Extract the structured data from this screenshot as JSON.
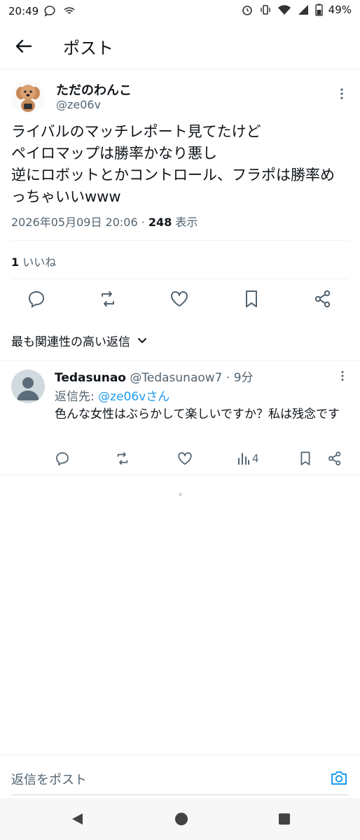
{
  "status_bar": {
    "time": "20:49",
    "battery": "49%"
  },
  "header": {
    "title": "ポスト"
  },
  "tweet": {
    "author_name": "ただのわんこ",
    "author_handle": "@ze06v",
    "text": "ライバルのマッチレポート見てたけど\nペイロマップは勝率かなり悪し\n逆にロボットとかコントロール、フラポは勝率めっちゃいいwww",
    "date": "2026年05月09日 20:06",
    "separator": "·",
    "views": "248",
    "views_label": "表示",
    "likes_count": "1",
    "likes_label": "いいね"
  },
  "sort": {
    "label": "最も関連性の高い返信"
  },
  "reply": {
    "author_name": "Tedasunao",
    "author_handle": "@Tedasunaow7",
    "time": "9分",
    "reply_to_label": "返信先:",
    "reply_to_handle": "@ze06vさん",
    "text": "色んな女性はぶらかして楽しいですか？私は残念です",
    "views": "4"
  },
  "compose": {
    "placeholder": "返信をポスト"
  },
  "colors": {
    "accent": "#1d9bf0",
    "text": "#0f1419",
    "muted": "#536471",
    "divider": "#eff3f4"
  },
  "icons": [
    "back-arrow-icon",
    "more-icon",
    "reply-icon",
    "repost-icon",
    "like-icon",
    "bookmark-icon",
    "share-icon",
    "views-icon",
    "chevron-down-icon",
    "camera-icon"
  ]
}
